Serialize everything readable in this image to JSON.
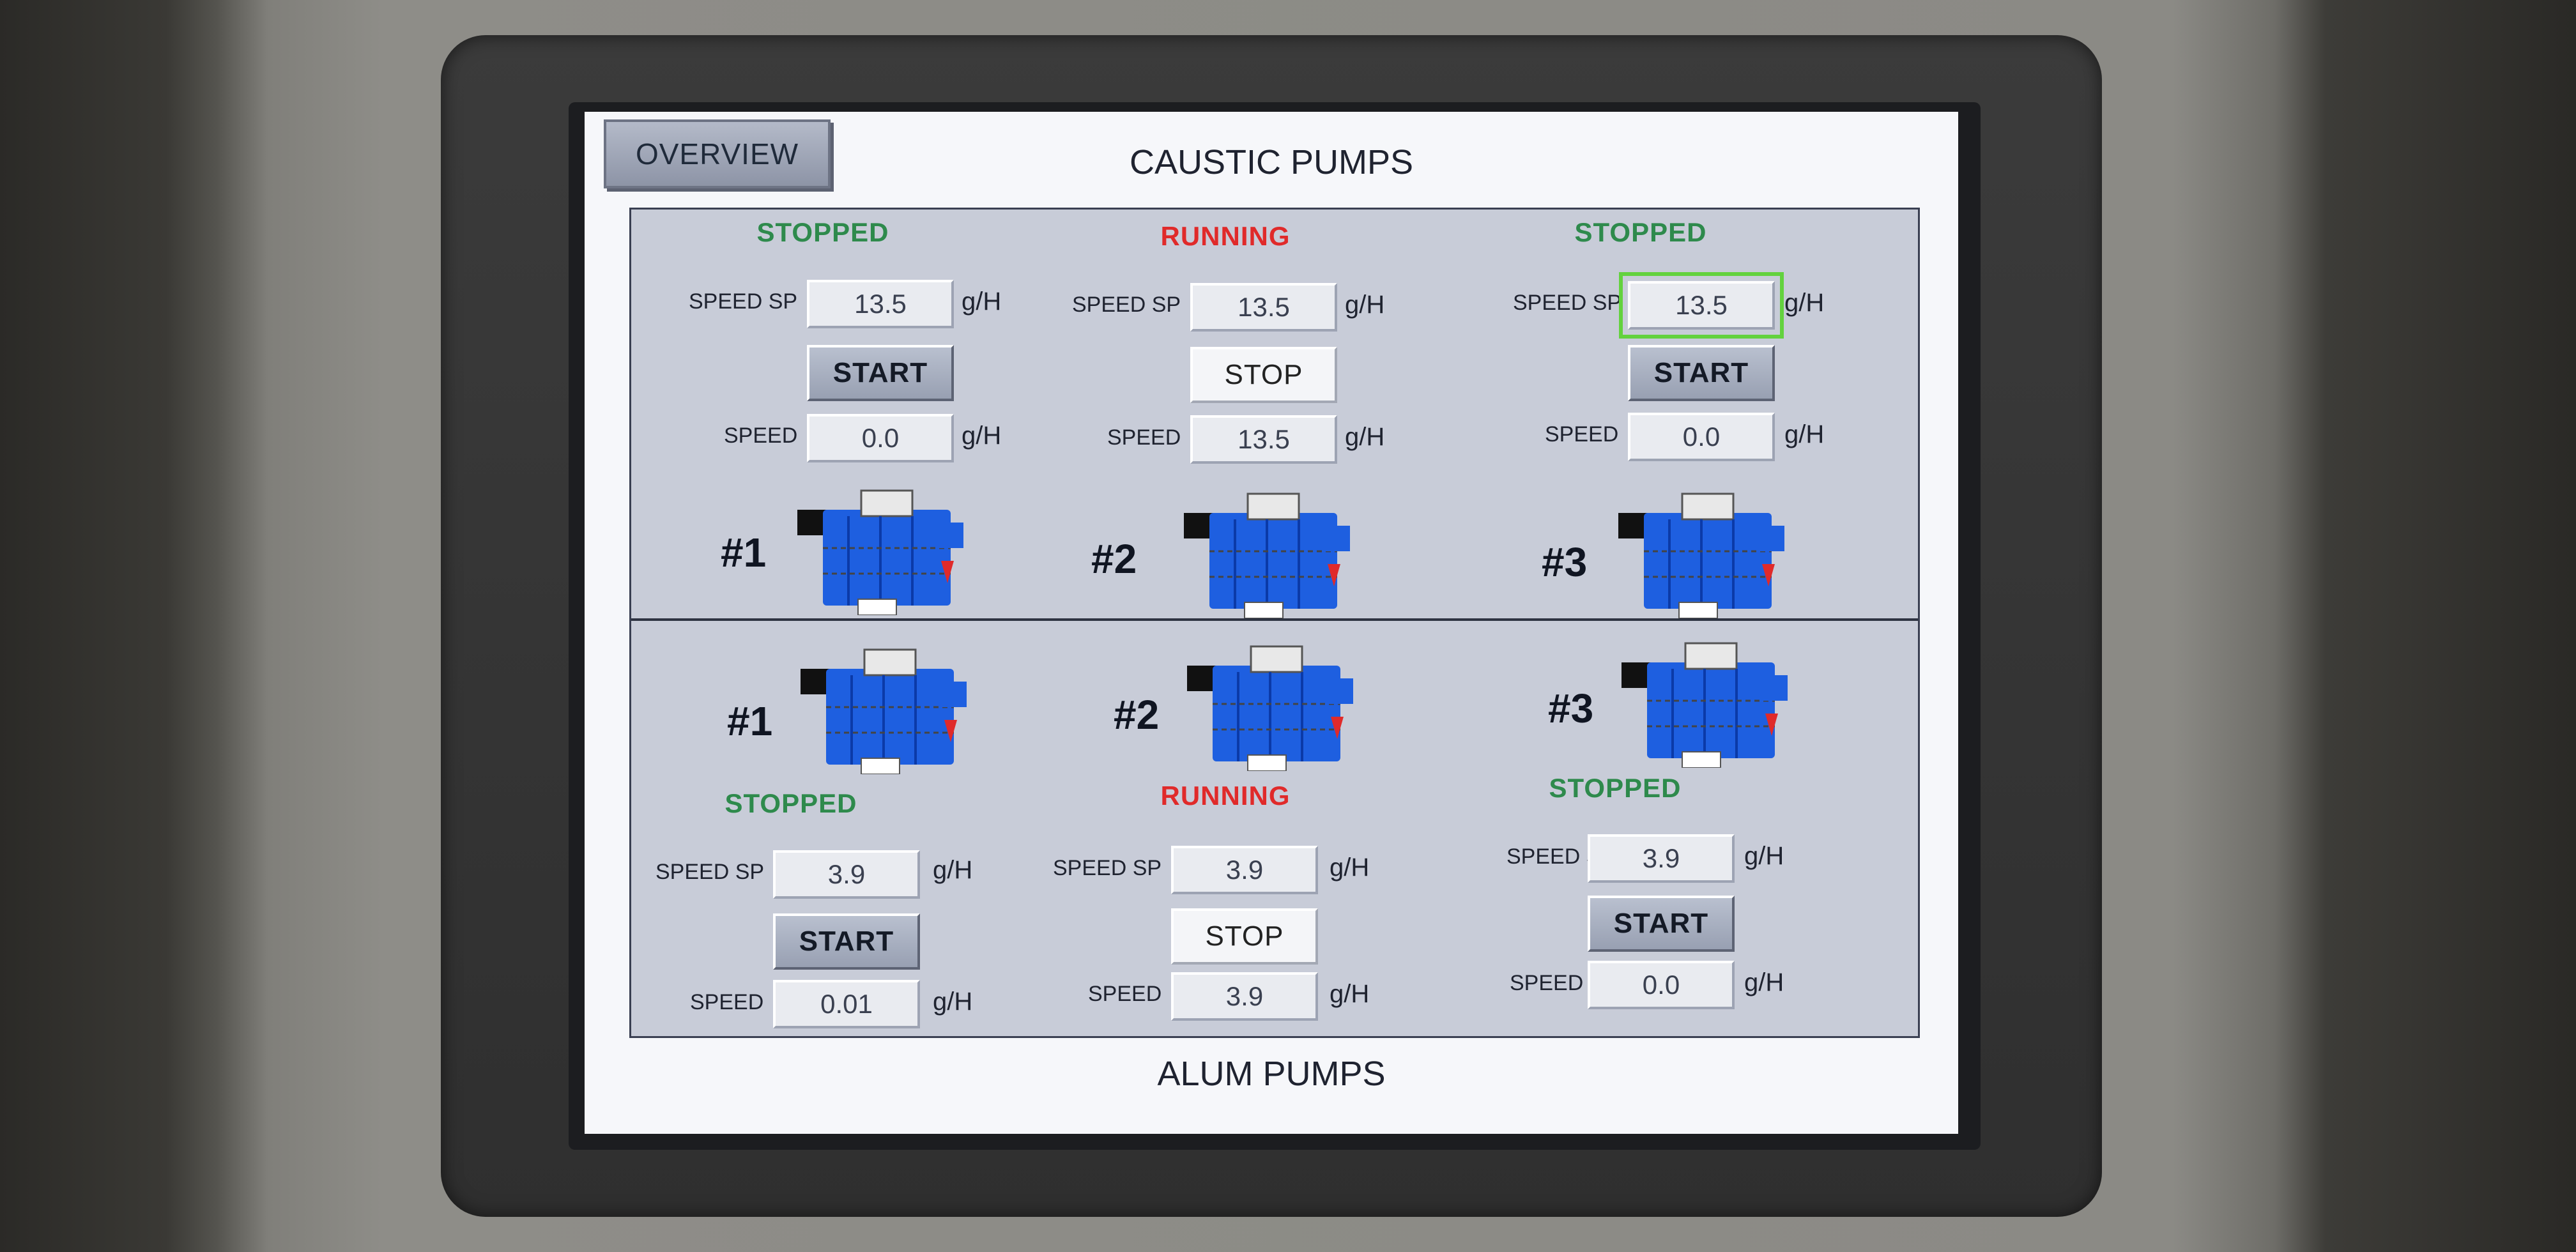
{
  "screen": {
    "overview_label": "OVERVIEW",
    "title_top": "CAUSTIC PUMPS",
    "title_bottom": "ALUM PUMPS"
  },
  "labels": {
    "speed_sp": "SPEED SP",
    "speed": "SPEED",
    "unit": "g/H"
  },
  "colors": {
    "stopped": "#2e8a4c",
    "running": "#e02a2a",
    "pump_blue": "#1e5fe0",
    "focus_outline": "#63d23e"
  },
  "caustic": [
    {
      "id": "#1",
      "status": "STOPPED",
      "speed_sp": "13.5",
      "button": "START",
      "speed": "0.0"
    },
    {
      "id": "#2",
      "status": "RUNNING",
      "speed_sp": "13.5",
      "button": "STOP",
      "speed": "13.5"
    },
    {
      "id": "#3",
      "status": "STOPPED",
      "speed_sp": "13.5",
      "button": "START",
      "speed": "0.0"
    }
  ],
  "alum": [
    {
      "id": "#1",
      "status": "STOPPED",
      "speed_sp": "3.9",
      "button": "START",
      "speed": "0.01"
    },
    {
      "id": "#2",
      "status": "RUNNING",
      "speed_sp": "3.9",
      "button": "STOP",
      "speed": "3.9"
    },
    {
      "id": "#3",
      "status": "STOPPED",
      "speed_sp": "3.9",
      "button": "START",
      "speed": "0.0"
    }
  ]
}
